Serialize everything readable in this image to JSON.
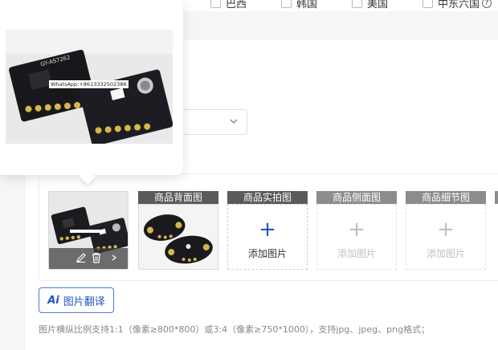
{
  "top_checkboxes": [
    {
      "label": "巴西"
    },
    {
      "label": "韩国"
    },
    {
      "label": "美国"
    },
    {
      "label": "中东六国"
    }
  ],
  "popover": {
    "watermark": "WhatsApp:+8613332502386"
  },
  "image_slots": [
    {
      "label": "商品背面图",
      "state": "filled"
    },
    {
      "label": "商品实拍图",
      "state": "empty",
      "add_text": "添加图片",
      "active": true
    },
    {
      "label": "商品侧面图",
      "state": "empty",
      "add_text": "添加图片",
      "active": false
    },
    {
      "label": "商品细节图",
      "state": "empty",
      "add_text": "添加图片",
      "active": false
    }
  ],
  "translate_button": {
    "icon_text": "Ai",
    "label": "图片翻译"
  },
  "hint": "图片横纵比例支持1:1（像素≥800*800）或3:4（像素≥750*1000），支持jpg、jpeg、png格式；",
  "colors": {
    "accent": "#1f56c4",
    "slot_label_bg": "#5a5a5a",
    "slot_label_bg_muted": "#8c8c8c"
  }
}
